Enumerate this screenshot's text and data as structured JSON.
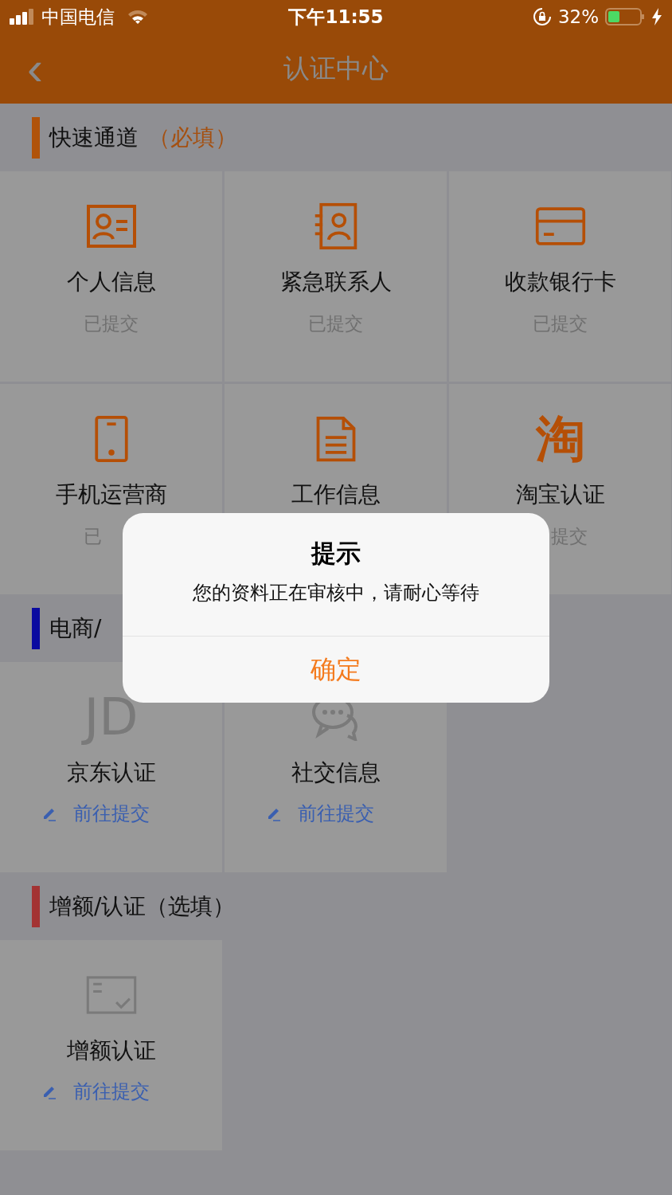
{
  "status_bar": {
    "carrier": "中国电信",
    "time": "下午11:55",
    "battery": "32%"
  },
  "nav": {
    "back": "‹",
    "title": "认证中心"
  },
  "sections": [
    {
      "title": "快速通道",
      "note": "（必填）",
      "color": "#b0530a",
      "cards": [
        {
          "kind": "done",
          "title": "个人信息",
          "status": "已提交"
        },
        {
          "kind": "done",
          "title": "紧急联系人",
          "status": "已提交"
        },
        {
          "kind": "done",
          "title": "收款银行卡",
          "status": "已提交"
        },
        {
          "kind": "done",
          "title": "手机运营商",
          "status": "已"
        },
        {
          "kind": "done",
          "title": "工作信息"
        },
        {
          "kind": "done",
          "title": "淘宝认证",
          "status": "提交",
          "logo_text": "淘"
        }
      ]
    },
    {
      "title": "电商/",
      "color": "#0a0aa0",
      "cards": [
        {
          "kind": "todo",
          "title": "京东认证",
          "link": "前往提交",
          "logo_text": "JD"
        },
        {
          "kind": "todo",
          "title": "社交信息",
          "link": "前往提交"
        }
      ]
    },
    {
      "title": "增额/认证（选填）",
      "color": "#a33333",
      "cards": [
        {
          "kind": "todo",
          "title": "增额认证",
          "link": "前往提交"
        }
      ]
    }
  ],
  "dialog": {
    "title": "提示",
    "message": "您的资料正在审核中，请耐心等待",
    "button": "确定"
  }
}
